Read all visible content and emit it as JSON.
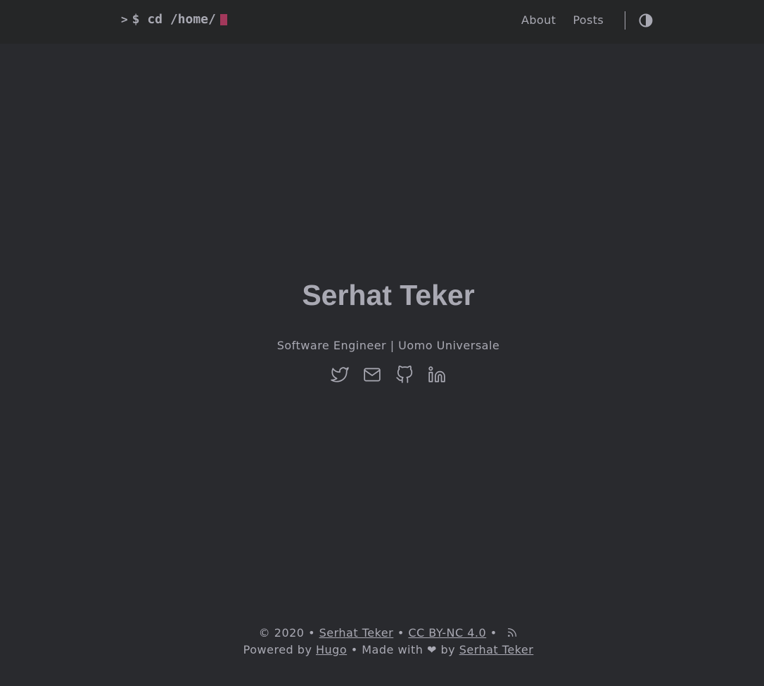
{
  "header": {
    "logo_prompt": ">",
    "logo_text": "$ cd /home/",
    "nav": [
      {
        "label": "About"
      },
      {
        "label": "Posts"
      }
    ],
    "theme_toggle_icon": "half-circle-icon"
  },
  "hero": {
    "title": "Serhat Teker",
    "subtitle": "Software Engineer | Uomo Universale",
    "social_icons": [
      "twitter-icon",
      "mail-icon",
      "github-icon",
      "linkedin-icon"
    ]
  },
  "footer": {
    "copyright": "© 2020 •",
    "author_link": "Serhat Teker",
    "sep": "•",
    "license_link": "CC BY-NC 4.0",
    "sep2": "•",
    "powered_by": "Powered by",
    "hugo_link": "Hugo",
    "made_with": "•  Made with ❤ by",
    "made_by_link": "Serhat Teker"
  },
  "colors": {
    "background": "#292a2e",
    "header_background": "#252627",
    "text": "#a9a9b3",
    "cursor": "#a2385b"
  }
}
